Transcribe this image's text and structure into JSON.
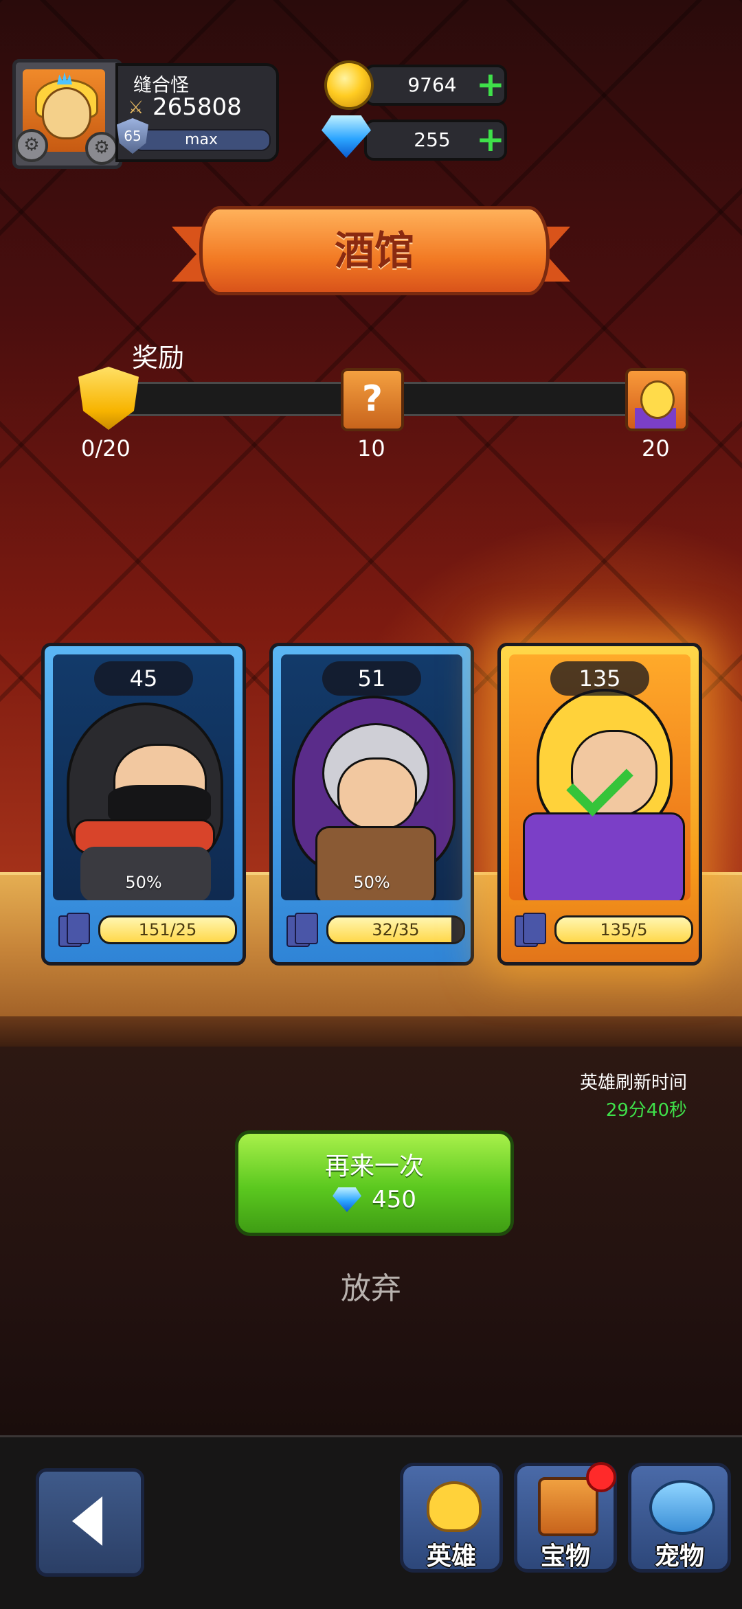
{
  "player": {
    "name": "缝合怪",
    "power": "265808",
    "level": "65",
    "level_status": "max"
  },
  "currency": {
    "gold": "9764",
    "gems": "255"
  },
  "banner": {
    "title": "酒馆"
  },
  "reward": {
    "label": "奖励",
    "progress": "0/20",
    "progress_fraction": 0,
    "milestones": [
      "10",
      "20"
    ]
  },
  "cards": [
    {
      "level": "45",
      "percent": "50%",
      "shards": "151/25",
      "shards_fraction": 1.0,
      "rarity": "blue",
      "character": "hooded-ninja"
    },
    {
      "level": "51",
      "percent": "50%",
      "shards": "32/35",
      "shards_fraction": 0.914,
      "rarity": "blue",
      "character": "elf-archer"
    },
    {
      "level": "135",
      "percent": "",
      "shards": "135/5",
      "shards_fraction": 1.0,
      "rarity": "gold",
      "character": "blonde-mage",
      "selected": true
    }
  ],
  "refresh": {
    "label": "英雄刷新时间",
    "time": "29分40秒"
  },
  "actions": {
    "again_label": "再来一次",
    "again_cost": "450",
    "give_up": "放弃"
  },
  "nav": {
    "heroes": "英雄",
    "treasure": "宝物",
    "pets": "宠物"
  },
  "colors": {
    "accent_green": "#3fe04a",
    "banner_orange": "#f27a24",
    "card_blue": "#2f84d6",
    "card_gold": "#f79a1a"
  }
}
